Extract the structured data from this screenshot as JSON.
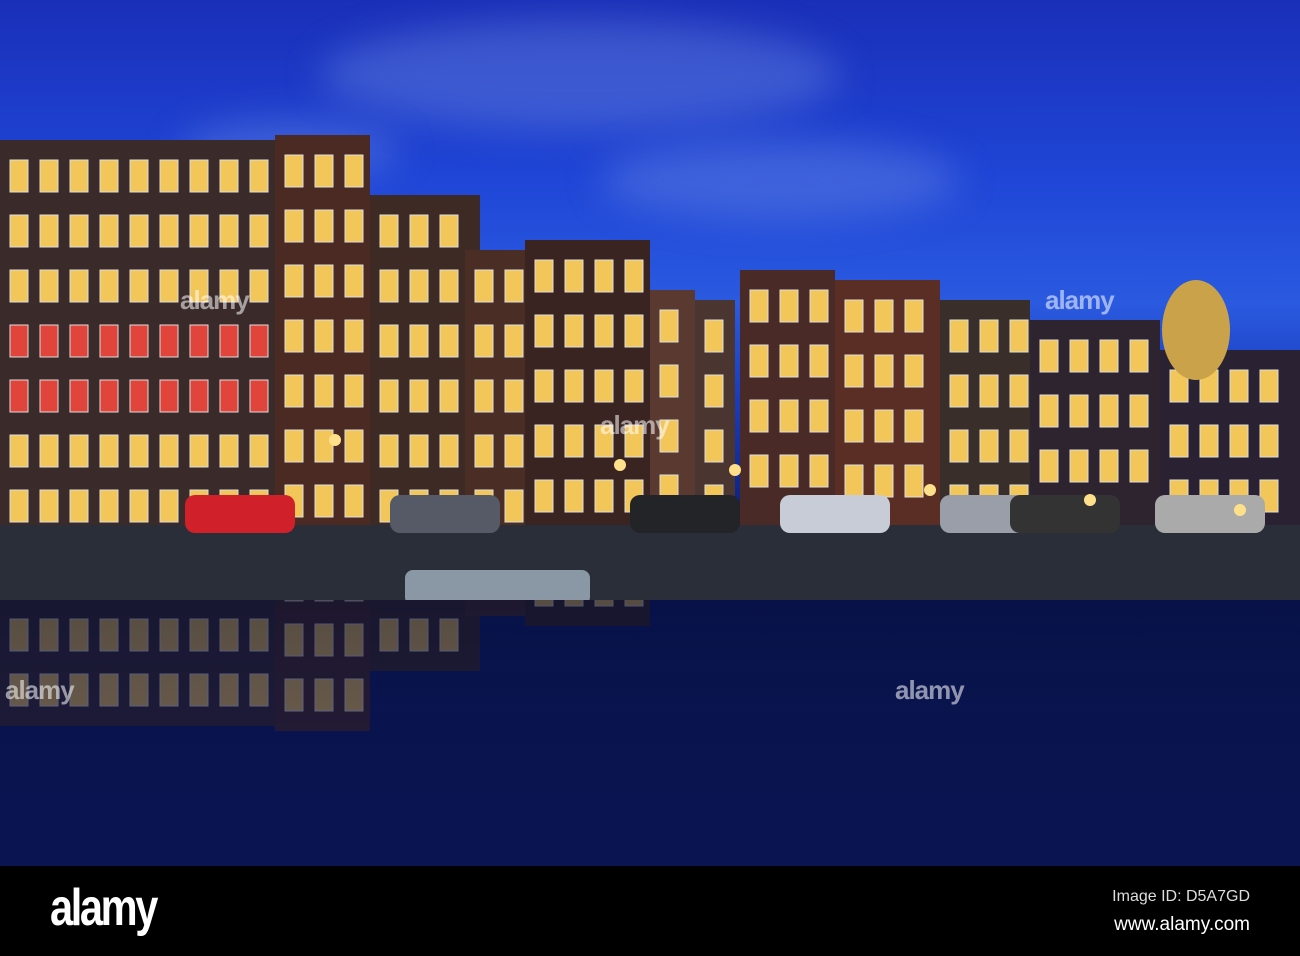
{
  "photo": {
    "subject": "Amsterdam canal houses at dusk",
    "colors": {
      "sky": "#1f45d6",
      "window": "#f3c65a",
      "window_red": "#e0443a",
      "brick": "#4a2a22"
    },
    "watermark_text": "alamy"
  },
  "footer": {
    "logo": "alamy",
    "image_id": "Image ID: D5A7GD",
    "website": "www.alamy.com"
  }
}
